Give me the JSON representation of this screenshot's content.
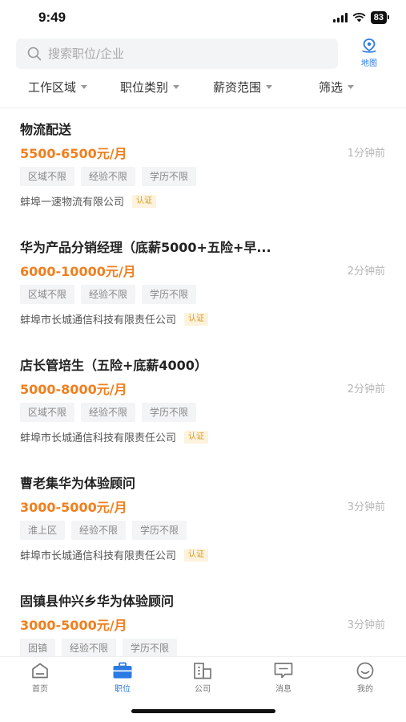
{
  "status": {
    "time": "9:49",
    "battery": "83"
  },
  "search": {
    "placeholder": "搜索职位/企业",
    "map_label": "地图"
  },
  "filters": [
    "工作区域",
    "职位类别",
    "薪资范围",
    "筛选"
  ],
  "jobs": [
    {
      "title": "物流配送",
      "salary": "5500-6500元/月",
      "time": "1分钟前",
      "tags": [
        "区域不限",
        "经验不限",
        "学历不限"
      ],
      "company": "蚌埠一速物流有限公司",
      "verified": "认证"
    },
    {
      "title": "华为产品分销经理（底薪5000+五险+早...",
      "salary": "6000-10000元/月",
      "time": "2分钟前",
      "tags": [
        "区域不限",
        "经验不限",
        "学历不限"
      ],
      "company": "蚌埠市长城通信科技有限责任公司",
      "verified": "认证"
    },
    {
      "title": "店长管培生（五险+底薪4000）",
      "salary": "5000-8000元/月",
      "time": "2分钟前",
      "tags": [
        "区域不限",
        "经验不限",
        "学历不限"
      ],
      "company": "蚌埠市长城通信科技有限责任公司",
      "verified": "认证"
    },
    {
      "title": "曹老集华为体验顾问",
      "salary": "3000-5000元/月",
      "time": "3分钟前",
      "tags": [
        "淮上区",
        "经验不限",
        "学历不限"
      ],
      "company": "蚌埠市长城通信科技有限责任公司",
      "verified": "认证"
    },
    {
      "title": "固镇县仲兴乡华为体验顾问",
      "salary": "3000-5000元/月",
      "time": "3分钟前",
      "tags": [
        "固镇",
        "经验不限",
        "学历不限"
      ],
      "company": "",
      "verified": ""
    }
  ],
  "tabs": [
    {
      "label": "首页",
      "icon": "home-icon"
    },
    {
      "label": "职位",
      "icon": "briefcase-icon"
    },
    {
      "label": "公司",
      "icon": "building-icon"
    },
    {
      "label": "消息",
      "icon": "message-icon"
    },
    {
      "label": "我的",
      "icon": "profile-icon"
    }
  ],
  "active_tab": 1,
  "colors": {
    "accent": "#2c7be5",
    "salary": "#f07f1e",
    "verified_text": "#d99a2b"
  }
}
